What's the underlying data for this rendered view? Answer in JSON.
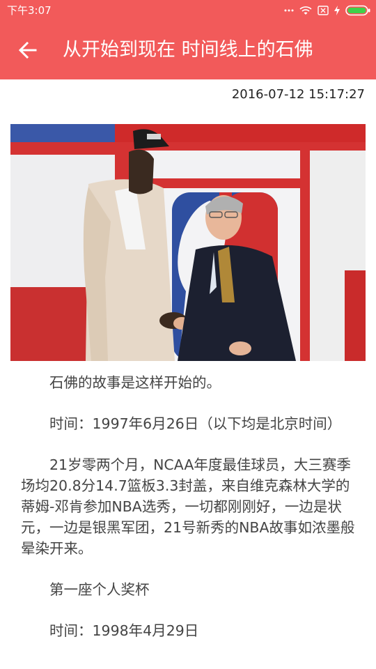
{
  "status_bar": {
    "time": "下午3:07",
    "icons": [
      "more-dots-icon",
      "wifi-icon",
      "sim-icon",
      "charging-icon",
      "battery-icon"
    ]
  },
  "toolbar": {
    "back_icon": "arrow-left-icon",
    "title": "从开始到现在 时间线上的石佛"
  },
  "article": {
    "timestamp": "2016-07-12 15:17:27",
    "paragraphs": [
      "石佛的故事是这样开始的。",
      "时间：1997年6月26日（以下均是北京时间）",
      "21岁零两个月，NCAA年度最佳球员，大三赛季场均20.8分14.7篮板3.3封盖，来自维克森林大学的蒂姆-邓肯参加NBA选秀，一切都刚刚好，一边是状元，一边是银黑军团，21号新秀的NBA故事如浓墨般晕染开来。",
      "第一座个人奖杯",
      "时间：1998年4月29日"
    ]
  },
  "colors": {
    "primary": "#f25a5a",
    "text": "#444444",
    "timestamp": "#222222"
  }
}
